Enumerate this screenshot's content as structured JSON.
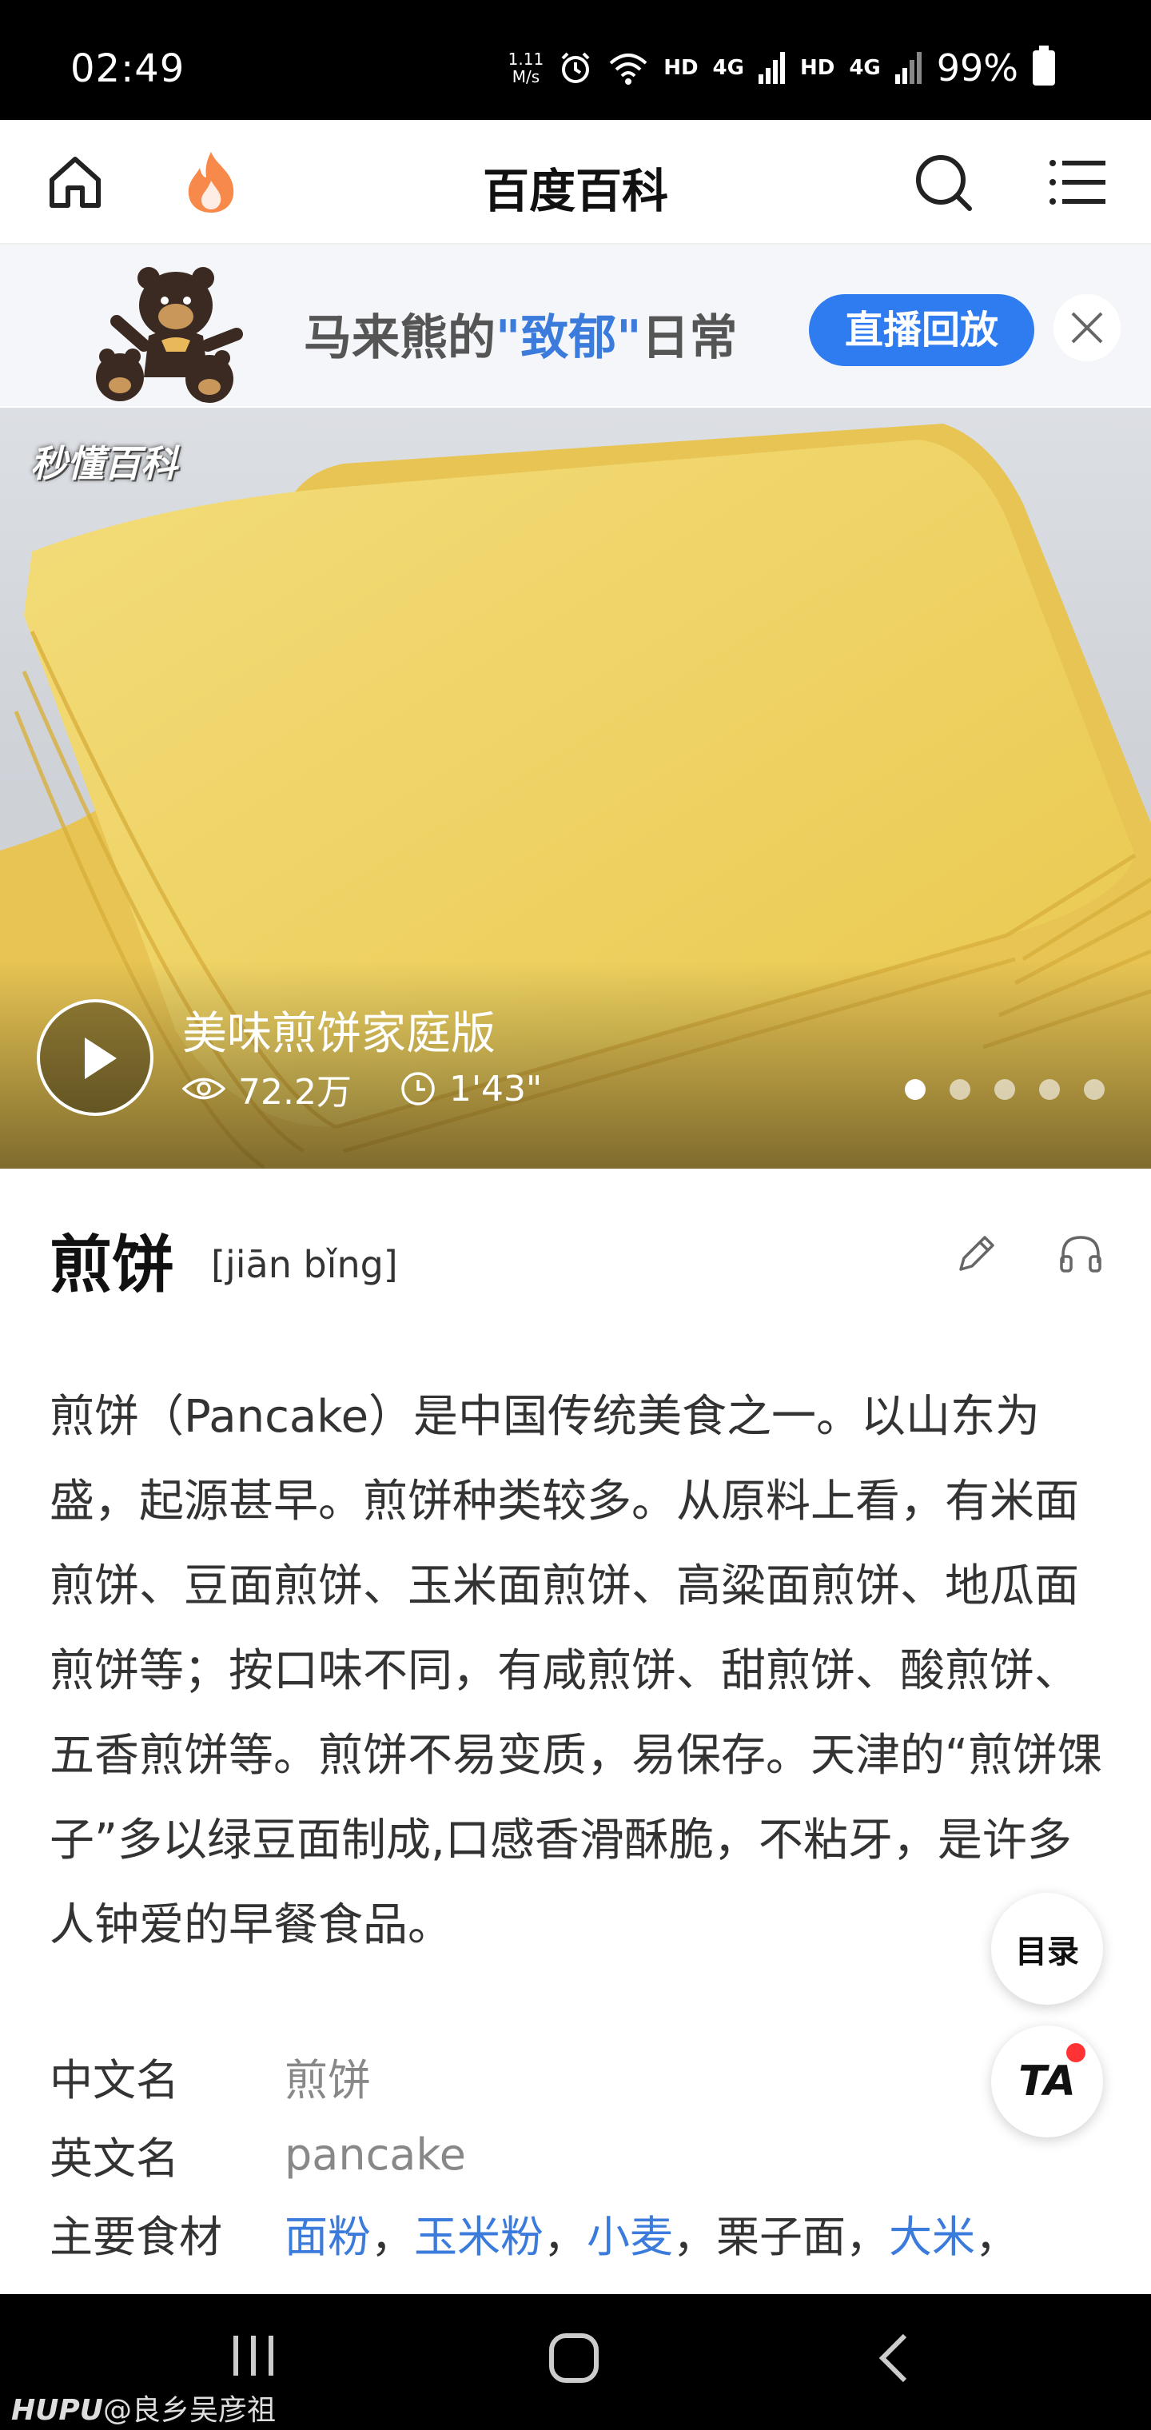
{
  "status_bar": {
    "time": "02:49",
    "net_speed_top": "1.11",
    "net_speed_bottom": "M/s",
    "hd1": "HD",
    "net1": "4G",
    "hd2": "HD",
    "net2": "4G",
    "battery": "99%"
  },
  "header": {
    "title": "百度百科",
    "icons": [
      "home-icon",
      "flame-icon",
      "search-icon",
      "menu-icon"
    ]
  },
  "banner": {
    "text_pre": "马来熊的",
    "text_highlight": "\"致郁\"",
    "text_post": "日常",
    "cta": "直播回放"
  },
  "hero": {
    "watermark": "秒懂百科",
    "video_title": "美味煎饼家庭版",
    "views": "72.2万",
    "duration": "1'43\"",
    "slides": 5,
    "active_slide": 1
  },
  "entry": {
    "title": "煎饼",
    "pinyin": "[jiān bǐng]",
    "summary": "煎饼（Pancake）是中国传统美食之一。以山东为盛，起源甚早。煎饼种类较多。从原料上看，有米面煎饼、豆面煎饼、玉米面煎饼、高粱面煎饼、地瓜面煎饼等；按口味不同，有咸煎饼、甜煎饼、酸煎饼、五香煎饼等。煎饼不易变质，易保存。天津的“煎饼馃子”多以绿豆面制成,口感香滑酥脆，不粘牙，是许多人钟爱的早餐食品。"
  },
  "info": {
    "chinese_name_label": "中文名",
    "chinese_name": "煎饼",
    "english_name_label": "英文名",
    "english_name": "pancake",
    "ingredients_label": "主要食材",
    "ingredients": [
      {
        "text": "面粉",
        "link": true
      },
      {
        "text": "玉米粉",
        "link": true
      },
      {
        "text": "小麦",
        "link": true
      },
      {
        "text": "栗子面",
        "link": false
      },
      {
        "text": "大米",
        "link": true
      }
    ],
    "separator": "，"
  },
  "floating": {
    "toc": "目录",
    "ta": "TA"
  },
  "nav": {
    "caption_brand": "HUPU",
    "caption_user": "@良乡吴彦祖"
  },
  "colors": {
    "accent": "#2f7bf0",
    "link": "#3a7bdc",
    "flame": "#f7894a"
  }
}
